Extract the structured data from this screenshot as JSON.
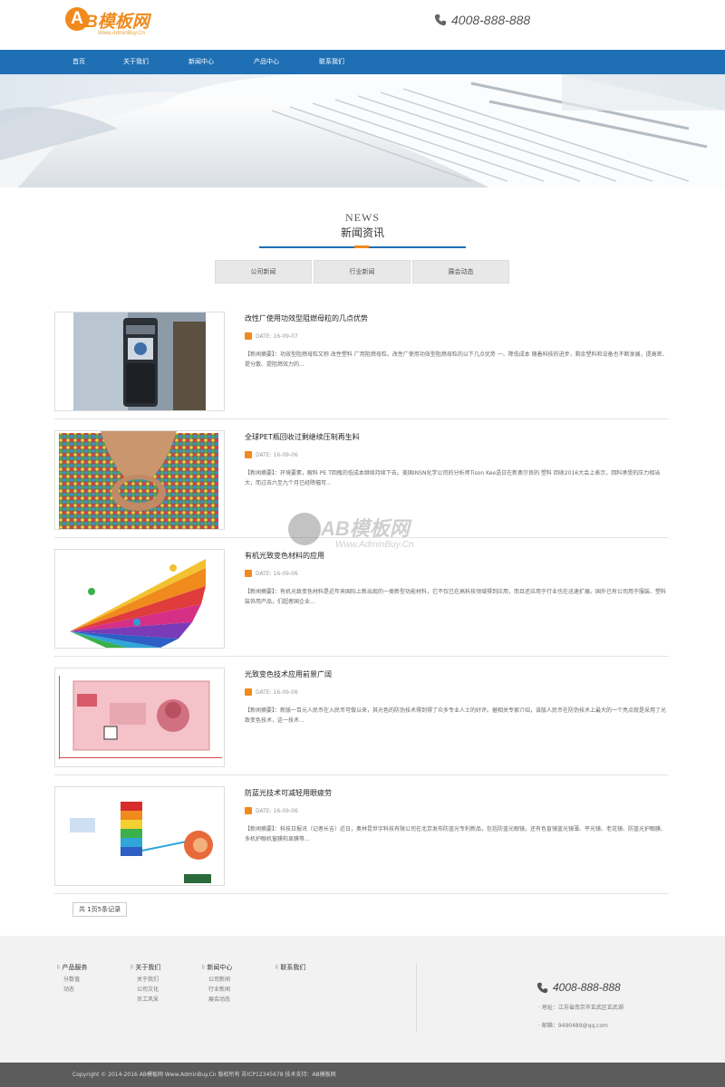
{
  "header": {
    "logo_mark": "A",
    "logo_text": "B模板网",
    "logo_sub": "Www.AdminBuy.Cn",
    "phone": "4008-888-888"
  },
  "nav": {
    "items": [
      "首页",
      "关于我们",
      "新闻中心",
      "产品中心",
      "联系我们"
    ]
  },
  "section": {
    "title_en": "NEWS",
    "title_cn": "新闻资讯"
  },
  "tabs": [
    "公司新闻",
    "行业新闻",
    "展会动态"
  ],
  "news": [
    {
      "title": "改性厂使用功效型阻燃母粒的几点优势",
      "date": "DATE: 16-09-07",
      "summary": "【新闻摘要】：功效型阻燃母粒又称 改性塑料 厂用阻燃母粒。改性厂使用功效型阻燃母粒的以下几点优势 一、降低成本 随着科技的进步，剩余塑料和设备也不断发展，提高密、提分散、提阻燃效力的..."
    },
    {
      "title": "全球PET瓶回收过剩继续压制再生料",
      "date": "DATE: 16-09-06",
      "summary": "【新闻摘要】：环境要素，解料 PE T回瓶的低成本继续持续下去。美国INSN化学公司的分析师Tison Kee语日在新奥尔良的 塑料 回收2016大会上表示，回料承受的压力相当大，而过去六至九个月已经降幅可..."
    },
    {
      "title": "有机光致变色材料的应用",
      "date": "DATE: 16-09-06",
      "summary": "【新闻摘要】：有机光致变色材料是近年来国际上新出现的一类新型功能材料，它不仅已在高科技领域得到应用，而且还应用于行业也在迅速扩展。国外已有公司用于服装、塑料装饰用产品，们超者国企业..."
    },
    {
      "title": "光致变色技术应用前景广阔",
      "date": "DATE: 16-09-06",
      "summary": "【新闻摘要】：新版一百元人民币在入民币可做以来，其光色的防伪技术得到得了众多专业人士的好评。据相关专家介绍，该版人民币在防伪技术上最大的一个亮点就是采用了光致变色技术，这一技术..."
    },
    {
      "title": "防蓝光技术可减轻用眼疲劳",
      "date": "DATE: 16-09-06",
      "summary": "【新闻摘要】：科技日报讯（记者长吉）近日，奥林昆世宇科技有限公司在北京发布防蓝光专利新品，包括防蓝光眼镜，还有色盲镜蓝光镜薄、平光镜、老花镜、防蓝光护眼膜、多机护眼机窗膜和显膜等..."
    }
  ],
  "watermark": {
    "text": "AB模板网",
    "sub": "Www.AdminBuy.Cn"
  },
  "pager": "共 1页5条记录",
  "footer": {
    "cols": [
      {
        "title": "产品服务",
        "links": [
          "分数值",
          "动态"
        ]
      },
      {
        "title": "关于我们",
        "links": [
          "关于我们",
          "公司文化",
          "员工风采"
        ]
      },
      {
        "title": "新闻中心",
        "links": [
          "公司新闻",
          "行业新闻",
          "展会动态"
        ]
      },
      {
        "title": "联系我们",
        "links": []
      }
    ],
    "phone": "4008-888-888",
    "address": "· 地址：江苏省南京市玄武区玄武湖",
    "email": "· 邮箱：9490489@qq.com",
    "copyright": "Copyright © 2014-2016 AB模板网 Www.AdminBuy.Cn 版权所有 苏ICP12345678 技术支持：AB模板网"
  },
  "colors": {
    "brand_orange": "#f08a1d",
    "nav_blue": "#1e6fb4"
  }
}
